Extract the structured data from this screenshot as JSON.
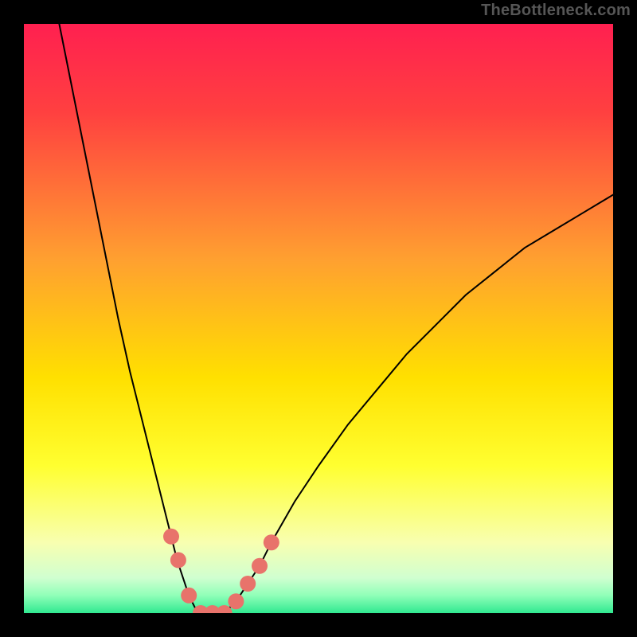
{
  "watermark": {
    "text": "TheBottleneck.com",
    "color": "#565656"
  },
  "chart_data": {
    "type": "line",
    "title": "",
    "xlabel": "",
    "ylabel": "",
    "xlim": [
      0,
      100
    ],
    "ylim": [
      0,
      100
    ],
    "grid": false,
    "legend": false,
    "background_gradient": {
      "stops": [
        {
          "pos": 0.0,
          "color": "#ff2050"
        },
        {
          "pos": 0.15,
          "color": "#ff4040"
        },
        {
          "pos": 0.4,
          "color": "#ffa030"
        },
        {
          "pos": 0.6,
          "color": "#ffe000"
        },
        {
          "pos": 0.75,
          "color": "#ffff30"
        },
        {
          "pos": 0.88,
          "color": "#f8ffb0"
        },
        {
          "pos": 0.94,
          "color": "#d0ffd0"
        },
        {
          "pos": 0.97,
          "color": "#90ffb8"
        },
        {
          "pos": 1.0,
          "color": "#30e890"
        }
      ]
    },
    "series": [
      {
        "name": "left-branch",
        "stroke": "#000000",
        "width": 2,
        "x": [
          6,
          8,
          10,
          12,
          14,
          16,
          18,
          20,
          22,
          23,
          24,
          25,
          26,
          27,
          28,
          29,
          30
        ],
        "y": [
          100,
          90,
          80,
          70,
          60,
          50,
          41,
          33,
          25,
          21,
          17,
          13,
          9,
          6,
          3,
          1,
          0
        ]
      },
      {
        "name": "right-branch",
        "stroke": "#000000",
        "width": 2,
        "x": [
          34,
          36,
          38,
          40,
          42,
          46,
          50,
          55,
          60,
          65,
          70,
          75,
          80,
          85,
          90,
          95,
          100
        ],
        "y": [
          0,
          2,
          5,
          8,
          12,
          19,
          25,
          32,
          38,
          44,
          49,
          54,
          58,
          62,
          65,
          68,
          71
        ]
      },
      {
        "name": "flat-minimum",
        "stroke": "#000000",
        "width": 2,
        "x": [
          30,
          31,
          32,
          33,
          34
        ],
        "y": [
          0,
          0,
          0,
          0,
          0
        ]
      }
    ],
    "markers": {
      "color": "#e8736b",
      "radius": 10,
      "points": [
        {
          "x": 25.0,
          "y": 13
        },
        {
          "x": 26.2,
          "y": 9
        },
        {
          "x": 28.0,
          "y": 3
        },
        {
          "x": 30.0,
          "y": 0
        },
        {
          "x": 32.0,
          "y": 0
        },
        {
          "x": 34.0,
          "y": 0
        },
        {
          "x": 36.0,
          "y": 2
        },
        {
          "x": 38.0,
          "y": 5
        },
        {
          "x": 40.0,
          "y": 8
        },
        {
          "x": 42.0,
          "y": 12
        }
      ]
    }
  }
}
